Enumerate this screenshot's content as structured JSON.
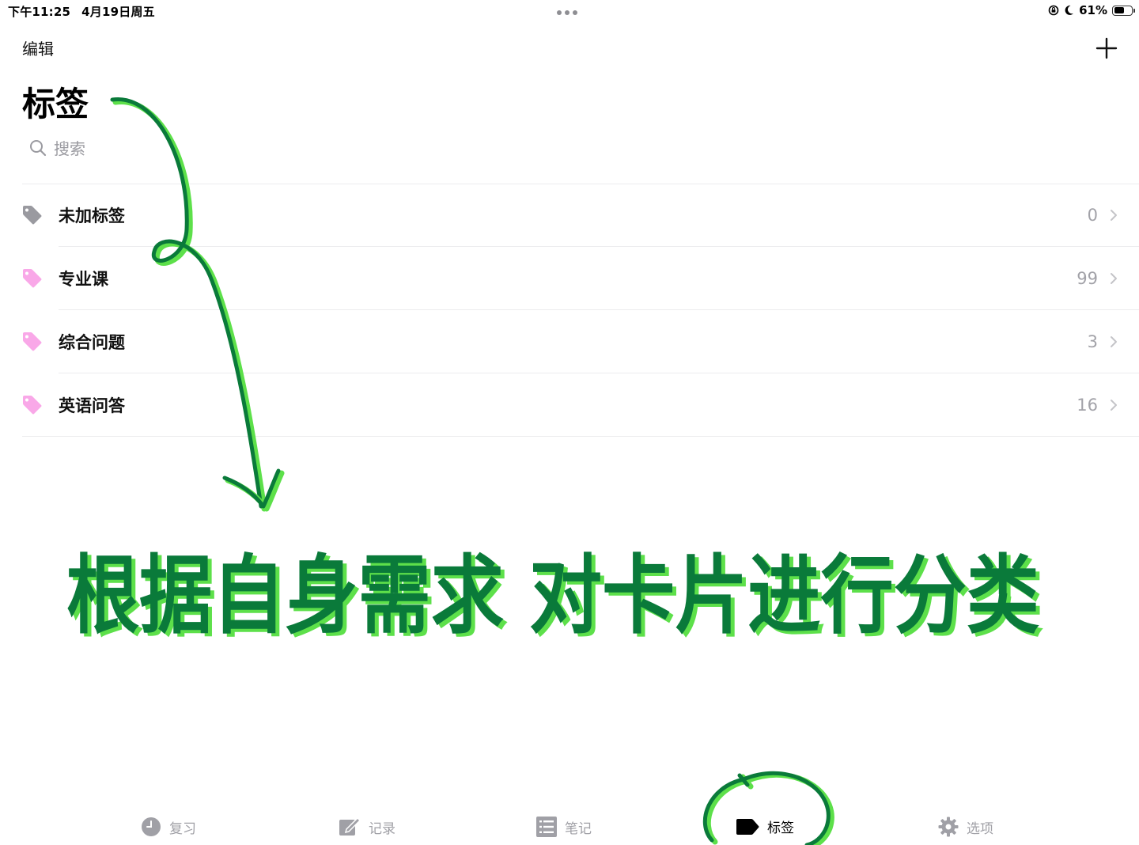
{
  "status_bar": {
    "time": "下午11:25",
    "date": "4月19日周五",
    "battery_percent": "61%",
    "battery_level": 0.61,
    "icons": [
      "rotation-lock-icon",
      "moon-icon",
      "battery-icon"
    ]
  },
  "nav": {
    "edit_label": "编辑",
    "add_icon": "plus-icon"
  },
  "page": {
    "title": "标签"
  },
  "search": {
    "placeholder": "搜索",
    "icon": "search-icon"
  },
  "tags": [
    {
      "label": "未加标签",
      "count": "0",
      "color": "#9a9aa0"
    },
    {
      "label": "专业课",
      "count": "99",
      "color": "#f9a8e8"
    },
    {
      "label": "综合问题",
      "count": "3",
      "color": "#f9a8e8"
    },
    {
      "label": "英语问答",
      "count": "16",
      "color": "#f9a8e8"
    }
  ],
  "tab_bar": {
    "items": [
      {
        "label": "复习",
        "icon": "clock-icon",
        "active": false
      },
      {
        "label": "记录",
        "icon": "compose-icon",
        "active": false
      },
      {
        "label": "笔记",
        "icon": "list-icon",
        "active": false
      },
      {
        "label": "标签",
        "icon": "tag-icon",
        "active": true
      },
      {
        "label": "选项",
        "icon": "gear-icon",
        "active": false
      }
    ]
  },
  "annotation": {
    "text": "根据自身需求 对卡片进行分类",
    "stroke_color": "#0a7a3a",
    "highlight_color": "#5de04a"
  }
}
